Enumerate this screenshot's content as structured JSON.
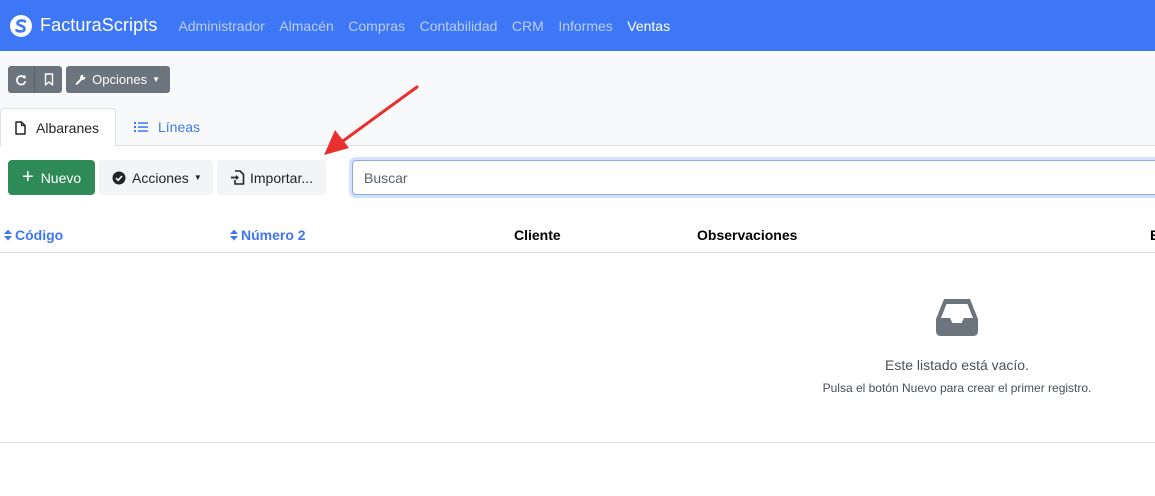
{
  "brand": {
    "name": "FacturaScripts"
  },
  "menu": [
    {
      "label": "Administrador",
      "active": false
    },
    {
      "label": "Almacén",
      "active": false
    },
    {
      "label": "Compras",
      "active": false
    },
    {
      "label": "Contabilidad",
      "active": false
    },
    {
      "label": "CRM",
      "active": false
    },
    {
      "label": "Informes",
      "active": false
    },
    {
      "label": "Ventas",
      "active": true
    }
  ],
  "toolbar_top": {
    "options_label": "Opciones",
    "icons": [
      "reload-icon",
      "bookmark-icon",
      "wrench-icon"
    ]
  },
  "tabs": [
    {
      "label": "Albaranes",
      "icon": "file-icon",
      "active": true
    },
    {
      "label": "Líneas",
      "icon": "list-icon",
      "active": false
    }
  ],
  "actions": {
    "new_label": "Nuevo",
    "actions_label": "Acciones",
    "import_label": "Importar...",
    "search_placeholder": "Buscar"
  },
  "table": {
    "columns": [
      {
        "label": "Código",
        "sortable": true
      },
      {
        "label": "Número 2",
        "sortable": true
      },
      {
        "label": "Cliente",
        "sortable": false
      },
      {
        "label": "Observaciones",
        "sortable": false
      },
      {
        "label": "E",
        "sortable": false
      }
    ]
  },
  "empty_state": {
    "icon": "inbox-icon",
    "title": "Este listado está vacío.",
    "subtitle": "Pulsa el botón Nuevo para crear el primer registro."
  },
  "colors": {
    "navbar": "#3e77f6",
    "new_button": "#2e8b57",
    "annotation_arrow": "#e8302e"
  }
}
